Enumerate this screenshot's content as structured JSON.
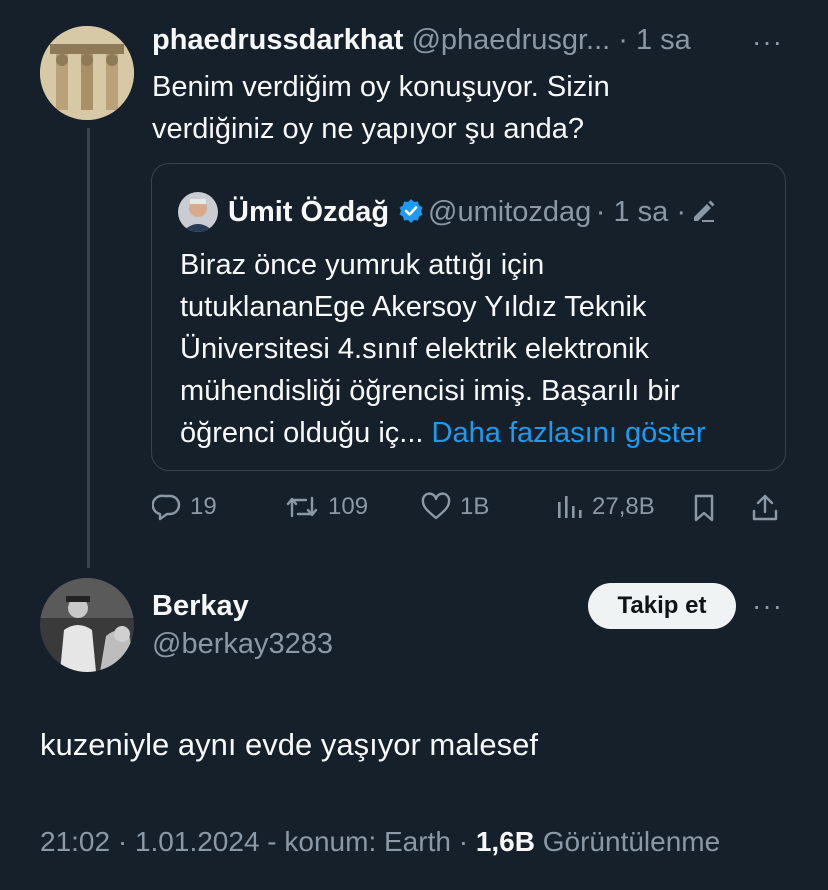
{
  "tweet": {
    "display_name": "phaedrussdarkhat",
    "handle": "@phaedrusgr...",
    "time": "· 1 sa",
    "more_label": "···",
    "text_line1": "Benim verdiğim oy konuşuyor. Sizin",
    "text_line2": "verdiğiniz oy ne yapıyor şu anda?",
    "quote": {
      "display_name": "Ümit Özdağ",
      "handle": "@umitozdag",
      "time": "· 1 sa ·",
      "lines": [
        "Biraz önce yumruk attığı için",
        "tutuklananEge Akersoy Yıldız Teknik",
        "Üniversitesi 4.sınıf elektrik elektronik",
        "mühendisliği öğrencisi imiş. Başarılı bir",
        "öğrenci olduğu iç..."
      ],
      "show_more": "Daha fazlasını göster"
    },
    "stats": {
      "replies": "19",
      "retweets": "109",
      "likes": "1B",
      "views": "27,8B"
    }
  },
  "reply": {
    "display_name": "Berkay",
    "handle": "@berkay3283",
    "follow_label": "Takip et",
    "more_label": "···",
    "text": "kuzeniyle aynı evde yaşıyor malesef",
    "meta_prefix": "21:02 · 1.01.2024 - konum: Earth ·",
    "view_count": "1,6B",
    "view_label": "Görüntülenme"
  },
  "colors": {
    "background": "#15202b",
    "text": "#f7f9f9",
    "muted": "#8b98a5",
    "border": "#38444d",
    "link": "#1d9bf0",
    "verified": "#1d9bf0"
  }
}
